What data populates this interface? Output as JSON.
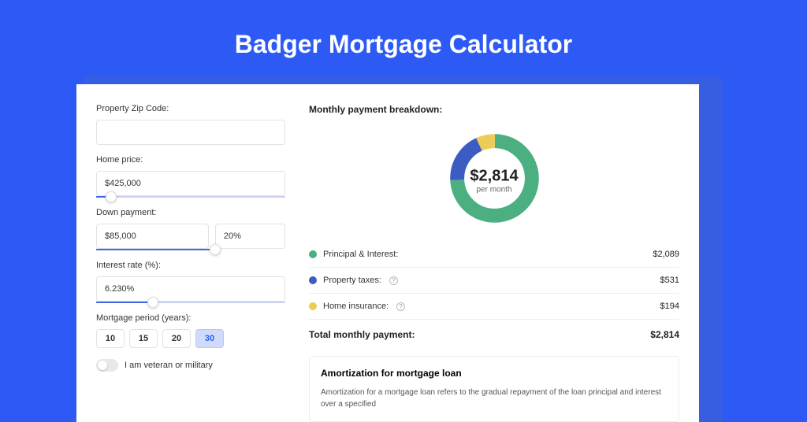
{
  "title": "Badger Mortgage Calculator",
  "form": {
    "zip_label": "Property Zip Code:",
    "zip_value": "",
    "price_label": "Home price:",
    "price_value": "$425,000",
    "price_slider_pct": 8,
    "down_label": "Down payment:",
    "down_value": "$85,000",
    "down_pct_value": "20%",
    "down_slider_pct": 20,
    "rate_label": "Interest rate (%):",
    "rate_value": "6.230%",
    "rate_slider_pct": 30,
    "period_label": "Mortgage period (years):",
    "periods": [
      "10",
      "15",
      "20",
      "30"
    ],
    "period_active": "30",
    "veteran_label": "I am veteran or military",
    "veteran_on": false
  },
  "breakdown": {
    "title": "Monthly payment breakdown:",
    "center_amount": "$2,814",
    "center_sub": "per month",
    "rows": [
      {
        "label": "Principal & Interest:",
        "color": "green",
        "value": "$2,089",
        "info": false
      },
      {
        "label": "Property taxes:",
        "color": "blue",
        "value": "$531",
        "info": true
      },
      {
        "label": "Home insurance:",
        "color": "yellow",
        "value": "$194",
        "info": true
      }
    ],
    "total_label": "Total monthly payment:",
    "total_value": "$2,814"
  },
  "chart_data": {
    "type": "pie",
    "title": "Monthly payment breakdown",
    "series": [
      {
        "name": "Principal & Interest",
        "value": 2089,
        "color": "#4CAF82"
      },
      {
        "name": "Property taxes",
        "value": 531,
        "color": "#3c5cc4"
      },
      {
        "name": "Home insurance",
        "value": 194,
        "color": "#eccc56"
      }
    ],
    "total": 2814
  },
  "amort": {
    "title": "Amortization for mortgage loan",
    "text": "Amortization for a mortgage loan refers to the gradual repayment of the loan principal and interest over a specified"
  }
}
